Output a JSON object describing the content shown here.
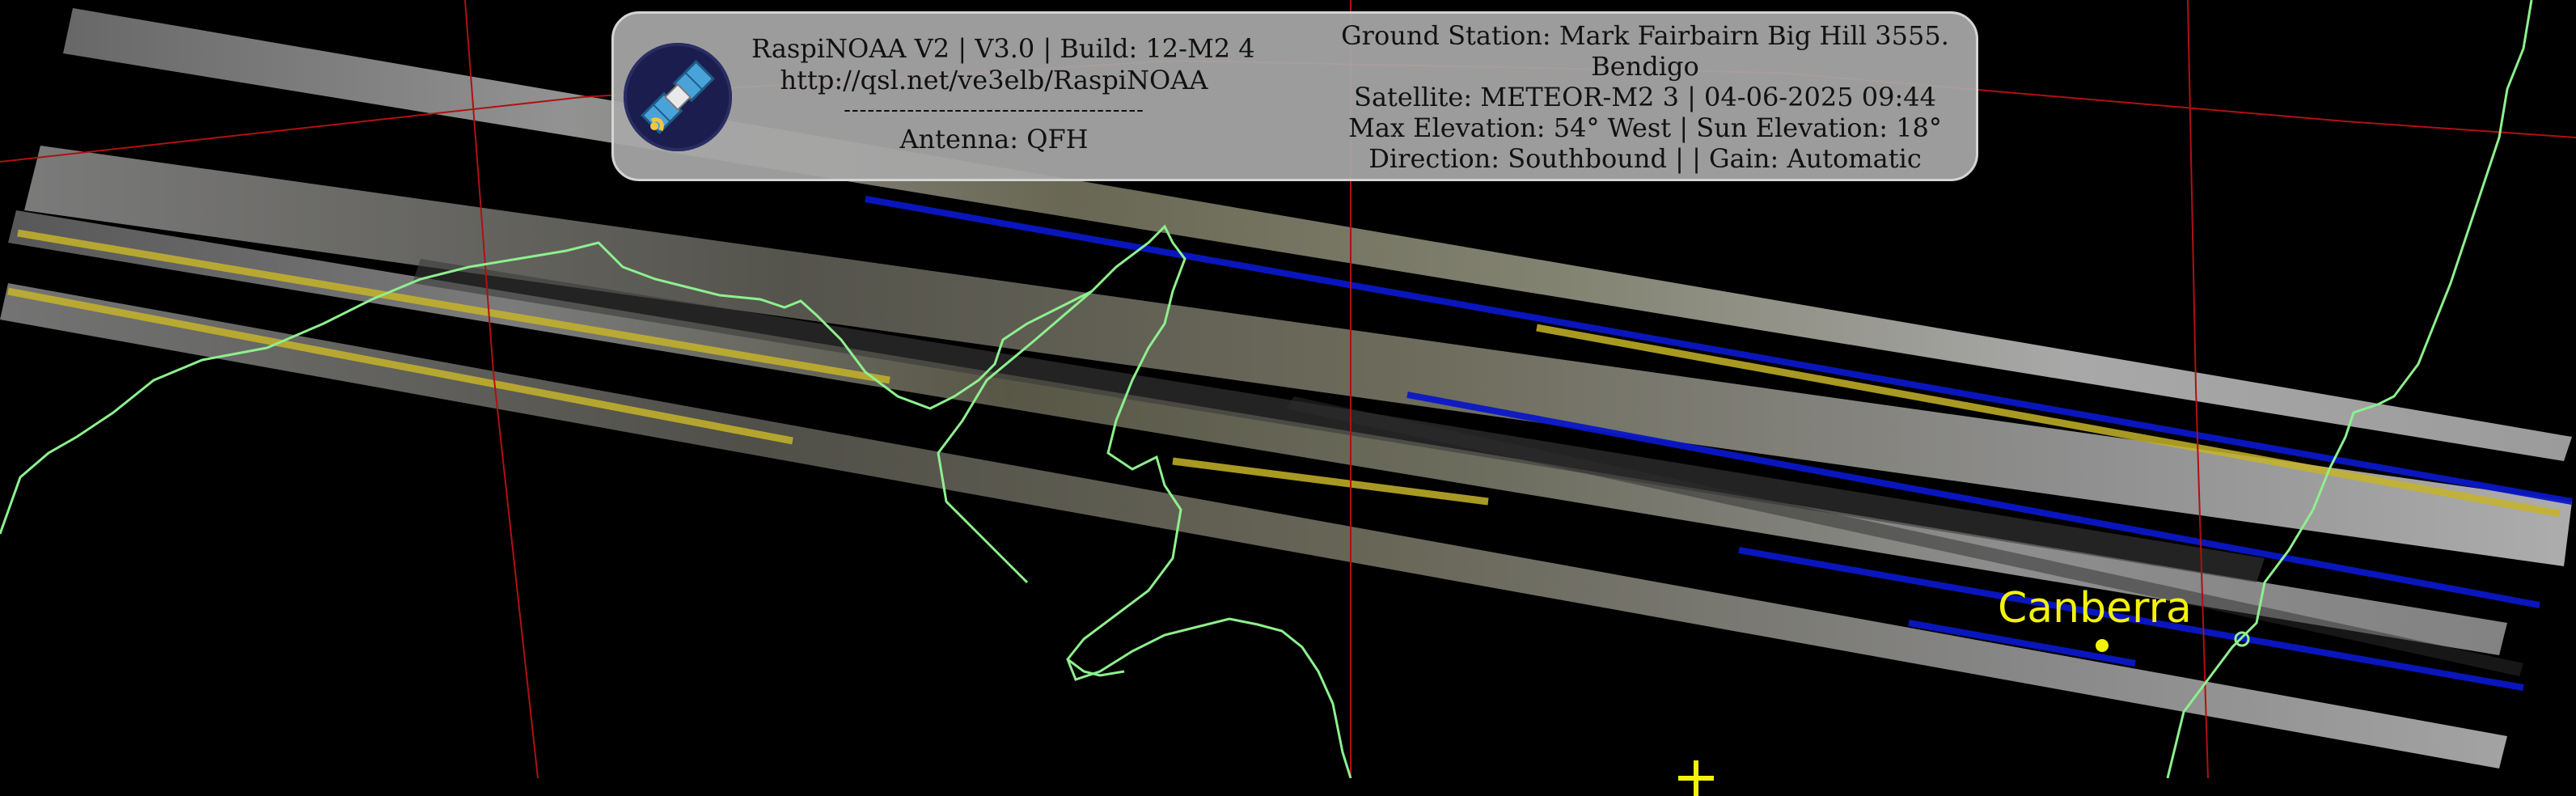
{
  "header": {
    "left_lines": [
      "RaspiNOAA V2 | V3.0 | Build: 12-M2 4",
      "http://qsl.net/ve3elb/RaspiNOAA",
      "--------------------------------------",
      "Antenna: QFH"
    ],
    "right_lines": [
      "Ground Station: Mark Fairbairn Big Hill 3555.",
      "Bendigo",
      "Satellite: METEOR-M2 3 | 04-06-2025 09:44",
      "Max Elevation: 54° West | Sun Elevation: 18°",
      "Direction: Southbound | | Gain: Automatic"
    ]
  },
  "map": {
    "city_label": "Canberra",
    "logo_icon": "satellite-icon",
    "station_marker_icon": "crosshair-plus-icon",
    "colors": {
      "background": "#000000",
      "coastline": "#8ef08e",
      "grid": "#b01010",
      "city": "#f2f20a",
      "overlay": "#a8a8a8"
    }
  }
}
